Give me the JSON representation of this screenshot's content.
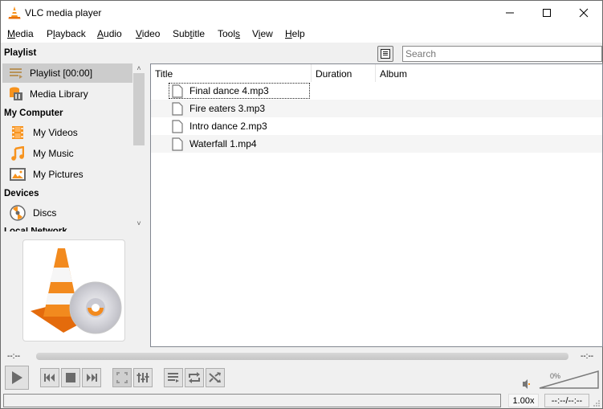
{
  "window": {
    "title": "VLC media player",
    "controls": {
      "minimize": "minimize",
      "maximize": "maximize",
      "close": "close"
    }
  },
  "menubar": [
    {
      "label": "Media",
      "mnemonic": "M"
    },
    {
      "label": "Playback",
      "mnemonic": "l"
    },
    {
      "label": "Audio",
      "mnemonic": "A"
    },
    {
      "label": "Video",
      "mnemonic": "V"
    },
    {
      "label": "Subtitle",
      "mnemonic": "t"
    },
    {
      "label": "Tools",
      "mnemonic": "s"
    },
    {
      "label": "View",
      "mnemonic": "i"
    },
    {
      "label": "Help",
      "mnemonic": "H"
    }
  ],
  "sidebar": {
    "sections": [
      {
        "header": "Playlist",
        "items": [
          {
            "label": "Playlist [00:00]",
            "icon": "playlist-icon",
            "selected": true
          },
          {
            "label": "Media Library",
            "icon": "media-library-icon",
            "selected": false
          }
        ]
      },
      {
        "header": "My Computer",
        "items": [
          {
            "label": "My Videos",
            "icon": "film-icon"
          },
          {
            "label": "My Music",
            "icon": "music-note-icon"
          },
          {
            "label": "My Pictures",
            "icon": "picture-icon"
          }
        ]
      },
      {
        "header": "Devices",
        "items": [
          {
            "label": "Discs",
            "icon": "disc-icon"
          }
        ]
      },
      {
        "header": "Local Network",
        "items": []
      }
    ]
  },
  "playlist": {
    "search_placeholder": "Search",
    "search_value": "",
    "columns": [
      "Title",
      "Duration",
      "Album"
    ],
    "rows": [
      {
        "title": "Final dance 4.mp3",
        "duration": "",
        "album": "",
        "focused": true
      },
      {
        "title": "Fire eaters 3.mp3",
        "duration": "",
        "album": ""
      },
      {
        "title": "Intro dance 2.mp3",
        "duration": "",
        "album": ""
      },
      {
        "title": "Waterfall 1.mp4",
        "duration": "",
        "album": ""
      }
    ]
  },
  "controls": {
    "time_elapsed": "--:--",
    "time_remaining": "--:--",
    "seek_progress": 0,
    "buttons": [
      "play",
      "previous",
      "stop",
      "next",
      "fullscreen",
      "extended-settings",
      "toggle-playlist",
      "loop",
      "shuffle"
    ],
    "volume_percent": "0%",
    "volume_value": 0,
    "playback_rate": "1.00x",
    "elapsed_total": "--:--/--:--",
    "status_text": ""
  },
  "colors": {
    "accent_orange": "#f7931e",
    "selected_bg": "#cccccc"
  }
}
